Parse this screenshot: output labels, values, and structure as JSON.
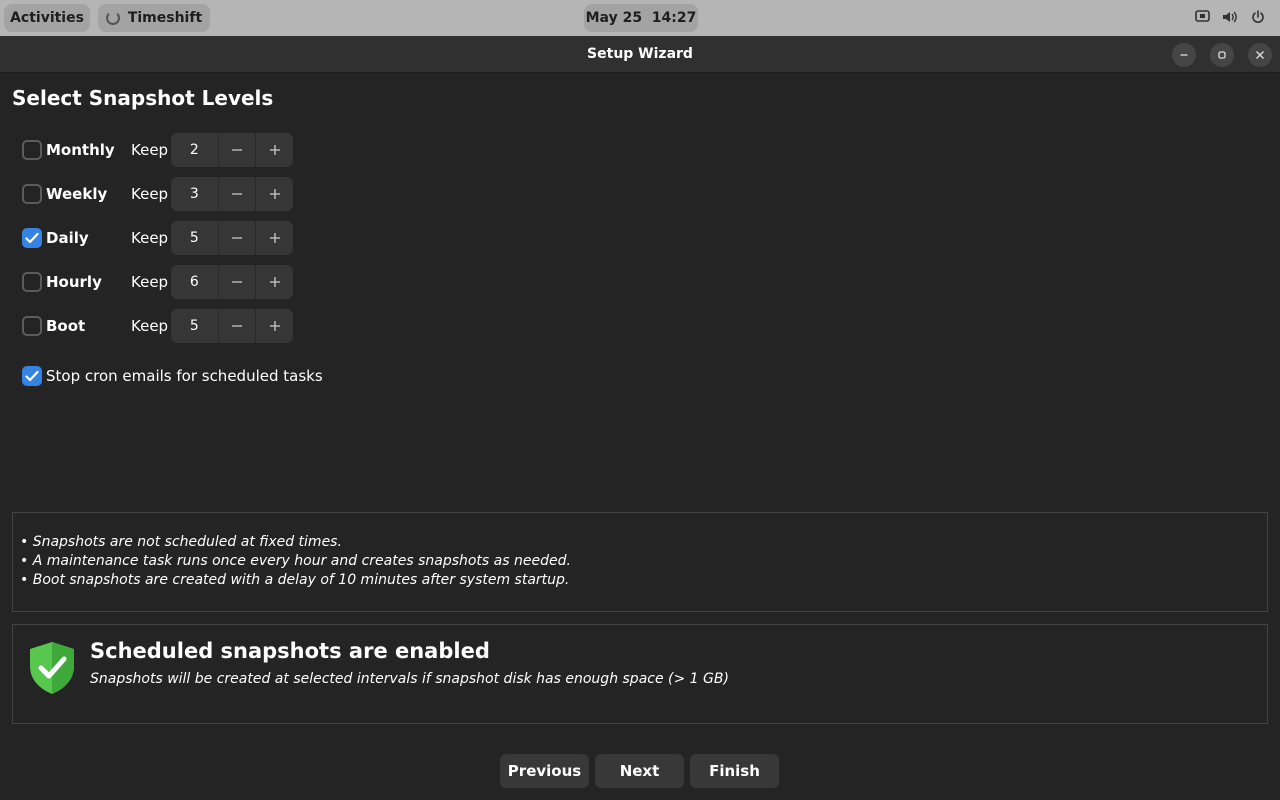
{
  "topbar": {
    "activities": "Activities",
    "app": "Timeshift",
    "clock": "May 25  14:27",
    "tray_icons": [
      "screen-share-icon",
      "volume-icon",
      "power-icon"
    ]
  },
  "window": {
    "title": "Setup Wizard"
  },
  "page": {
    "heading": "Select Snapshot Levels",
    "keep_label": "Keep",
    "levels": [
      {
        "label": "Monthly",
        "checked": false,
        "value": "2"
      },
      {
        "label": "Weekly",
        "checked": false,
        "value": "3"
      },
      {
        "label": "Daily",
        "checked": true,
        "value": "5"
      },
      {
        "label": "Hourly",
        "checked": false,
        "value": "6"
      },
      {
        "label": "Boot",
        "checked": false,
        "value": "5"
      }
    ],
    "cron": {
      "label": "Stop cron emails for scheduled tasks",
      "checked": true
    },
    "notes": [
      "• Snapshots are not scheduled at fixed times.",
      "• A maintenance task runs once every hour and creates snapshots as needed.",
      "• Boot snapshots are created with a delay of 10 minutes after system startup."
    ],
    "status": {
      "title": "Scheduled snapshots are enabled",
      "subtitle": "Snapshots will be created at selected intervals if snapshot disk has enough space (> 1 GB)",
      "icon": "shield-check-icon",
      "icon_color": "#57c84d"
    }
  },
  "buttons": {
    "previous": "Previous",
    "next": "Next",
    "finish": "Finish"
  },
  "colors": {
    "accent": "#3584e4",
    "background": "#242424"
  }
}
